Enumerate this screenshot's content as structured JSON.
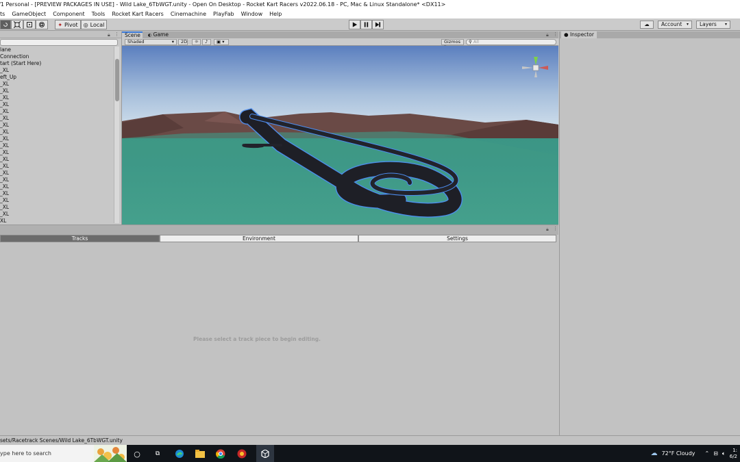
{
  "window": {
    "title": "f1 Personal - [PREVIEW PACKAGES IN USE] - Wild Lake_6TbWGT.unity - Open On Desktop - Rocket Kart Racers v2022.06.18 - PC, Mac & Linux Standalone* <DX11>"
  },
  "menu": [
    "ts",
    "GameObject",
    "Component",
    "Tools",
    "Rocket Kart Racers",
    "Cinemachine",
    "PlayFab",
    "Window",
    "Help"
  ],
  "toolbar": {
    "pivot_label": "Pivot",
    "local_label": "Local",
    "account_label": "Account",
    "layers_label": "Layers"
  },
  "hierarchy": {
    "items": [
      "lane",
      "Connection",
      "tart (Start Here)",
      "_XL",
      "eft_Up",
      "_XL",
      "_XL",
      "_XL",
      "_XL",
      "_XL",
      "_XL",
      "_XL",
      "_XL",
      "_XL",
      "_XL",
      "_XL",
      "_XL",
      "_XL",
      "_XL",
      "_XL",
      "_XL",
      "_XL",
      "_XL",
      "_XL",
      "_XL",
      "XL"
    ]
  },
  "scene": {
    "tabs": [
      "Scene",
      "Game"
    ],
    "shading_mode": "Shaded",
    "mode_2d": "2D",
    "gizmos_label": "Gizmos",
    "search_placeholder": "All",
    "colors": {
      "sky_top": "#5b7fbf",
      "sky_horizon": "#d7e4ee",
      "water": "#3f9a86",
      "mountains": "#6a4a46",
      "track": "#1e1f26",
      "track_edge": "#4d8df0"
    }
  },
  "inspector": {
    "tab_label": "Inspector"
  },
  "track_editor": {
    "tabs": [
      "Tracks",
      "Environment",
      "Settings"
    ],
    "selected_tab": "Tracks",
    "message": "Please select a track piece to begin editing."
  },
  "status_bar": {
    "path": "sets/Racetrack Scenes/Wild Lake_6TbWGT.unity"
  },
  "taskbar": {
    "search_placeholder": "ype here to search",
    "weather": "72°F  Cloudy",
    "clock_time": "1:",
    "clock_date": "6/2"
  }
}
